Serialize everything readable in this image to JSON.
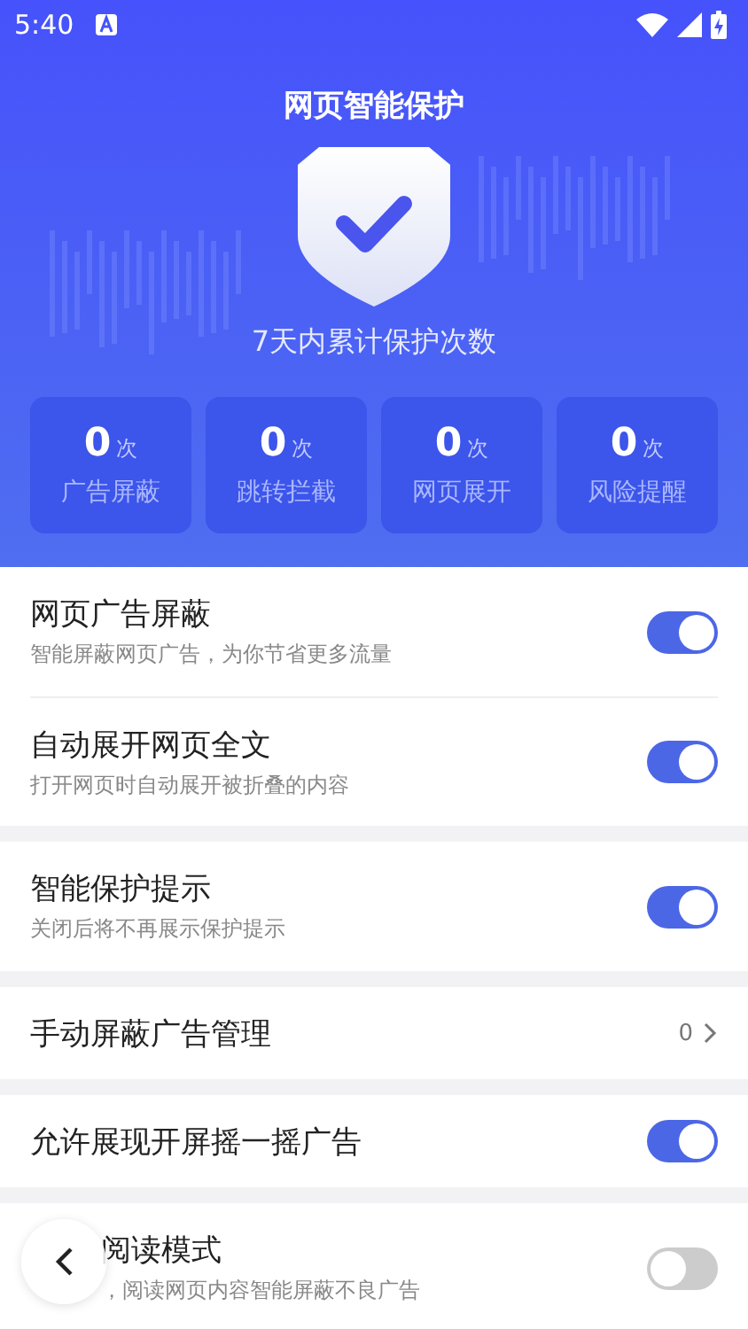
{
  "status_bar": {
    "time": "5:40"
  },
  "header": {
    "title": "网页智能保护",
    "subtitle": "7天内累计保护次数"
  },
  "stats": [
    {
      "value": "0",
      "unit": "次",
      "label": "广告屏蔽"
    },
    {
      "value": "0",
      "unit": "次",
      "label": "跳转拦截"
    },
    {
      "value": "0",
      "unit": "次",
      "label": "网页展开"
    },
    {
      "value": "0",
      "unit": "次",
      "label": "风险提醒"
    }
  ],
  "groups": [
    [
      {
        "kind": "toggle",
        "title": "网页广告屏蔽",
        "subtitle": "智能屏蔽网页广告，为你节省更多流量",
        "on": true
      },
      {
        "kind": "toggle",
        "title": "自动展开网页全文",
        "subtitle": "打开网页时自动展开被折叠的内容",
        "on": true
      }
    ],
    [
      {
        "kind": "toggle",
        "title": "智能保护提示",
        "subtitle": "关闭后将不再展示保护提示",
        "on": true
      }
    ],
    [
      {
        "kind": "link",
        "title": "手动屏蔽广告管理",
        "value": "0"
      }
    ],
    [
      {
        "kind": "toggle",
        "title": "允许展现开屏摇一摇广告",
        "on": true
      }
    ],
    [
      {
        "kind": "toggle",
        "title": "阅读模式",
        "subtitle": "，阅读网页内容智能屏蔽不良广告",
        "on": false,
        "obscured": true
      }
    ]
  ]
}
